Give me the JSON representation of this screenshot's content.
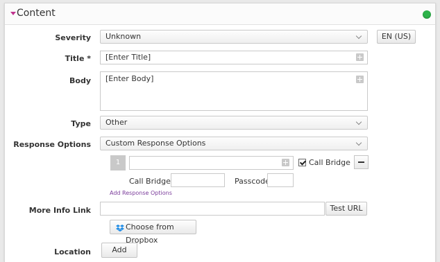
{
  "header": {
    "title": "Content"
  },
  "labels": {
    "severity": "Severity",
    "title": "Title *",
    "body": "Body",
    "type": "Type",
    "response_options": "Response Options",
    "more_info_link": "More Info Link",
    "location": "Location"
  },
  "severity": {
    "value": "Unknown"
  },
  "language": {
    "label": "EN (US)"
  },
  "title_field": {
    "value": "[Enter Title]"
  },
  "body_field": {
    "value": "[Enter Body]"
  },
  "type": {
    "value": "Other"
  },
  "response_options": {
    "value": "Custom Response Options",
    "items": [
      {
        "number": "1",
        "value": "",
        "call_bridge_label": "Call Bridge",
        "call_bridge_checked": true
      }
    ],
    "call_bridge_number_label": "Call Bridge #",
    "call_bridge_number_value": "",
    "passcode_label": "Passcode",
    "passcode_value": "",
    "add_link": "Add Response Options"
  },
  "more_info": {
    "value": "",
    "test_url_label": "Test URL"
  },
  "dropbox": {
    "label": "Choose from Dropbox"
  },
  "location": {
    "add_label": "Add"
  },
  "colors": {
    "accent_arrow": "#c0338f",
    "status_dot": "#2db34a",
    "link": "#7a3b9a",
    "dropbox_blue": "#1f8ce6"
  },
  "icons": {
    "collapse": "triangle-down-icon",
    "status": "status-dot-icon",
    "add": "plus-icon",
    "remove": "minus-icon",
    "dropbox": "dropbox-icon",
    "dropdown": "chevron-down-icon"
  }
}
